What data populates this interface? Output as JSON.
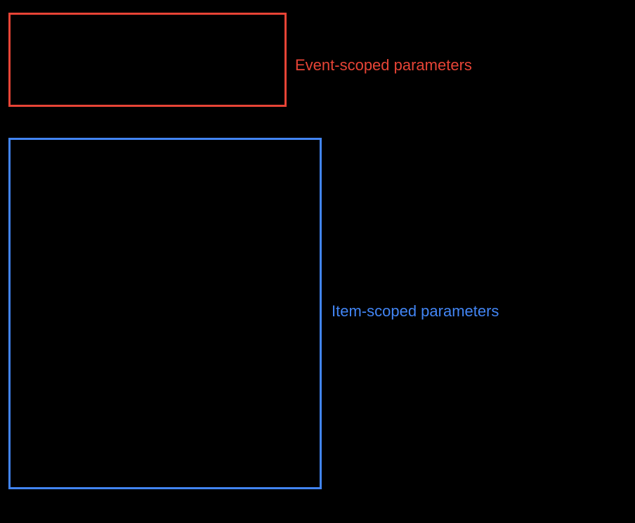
{
  "diagram": {
    "event_scope": {
      "label": "Event-scoped parameters",
      "color": "#E74436"
    },
    "item_scope": {
      "label": "Item-scoped parameters",
      "color": "#4285F4"
    }
  }
}
